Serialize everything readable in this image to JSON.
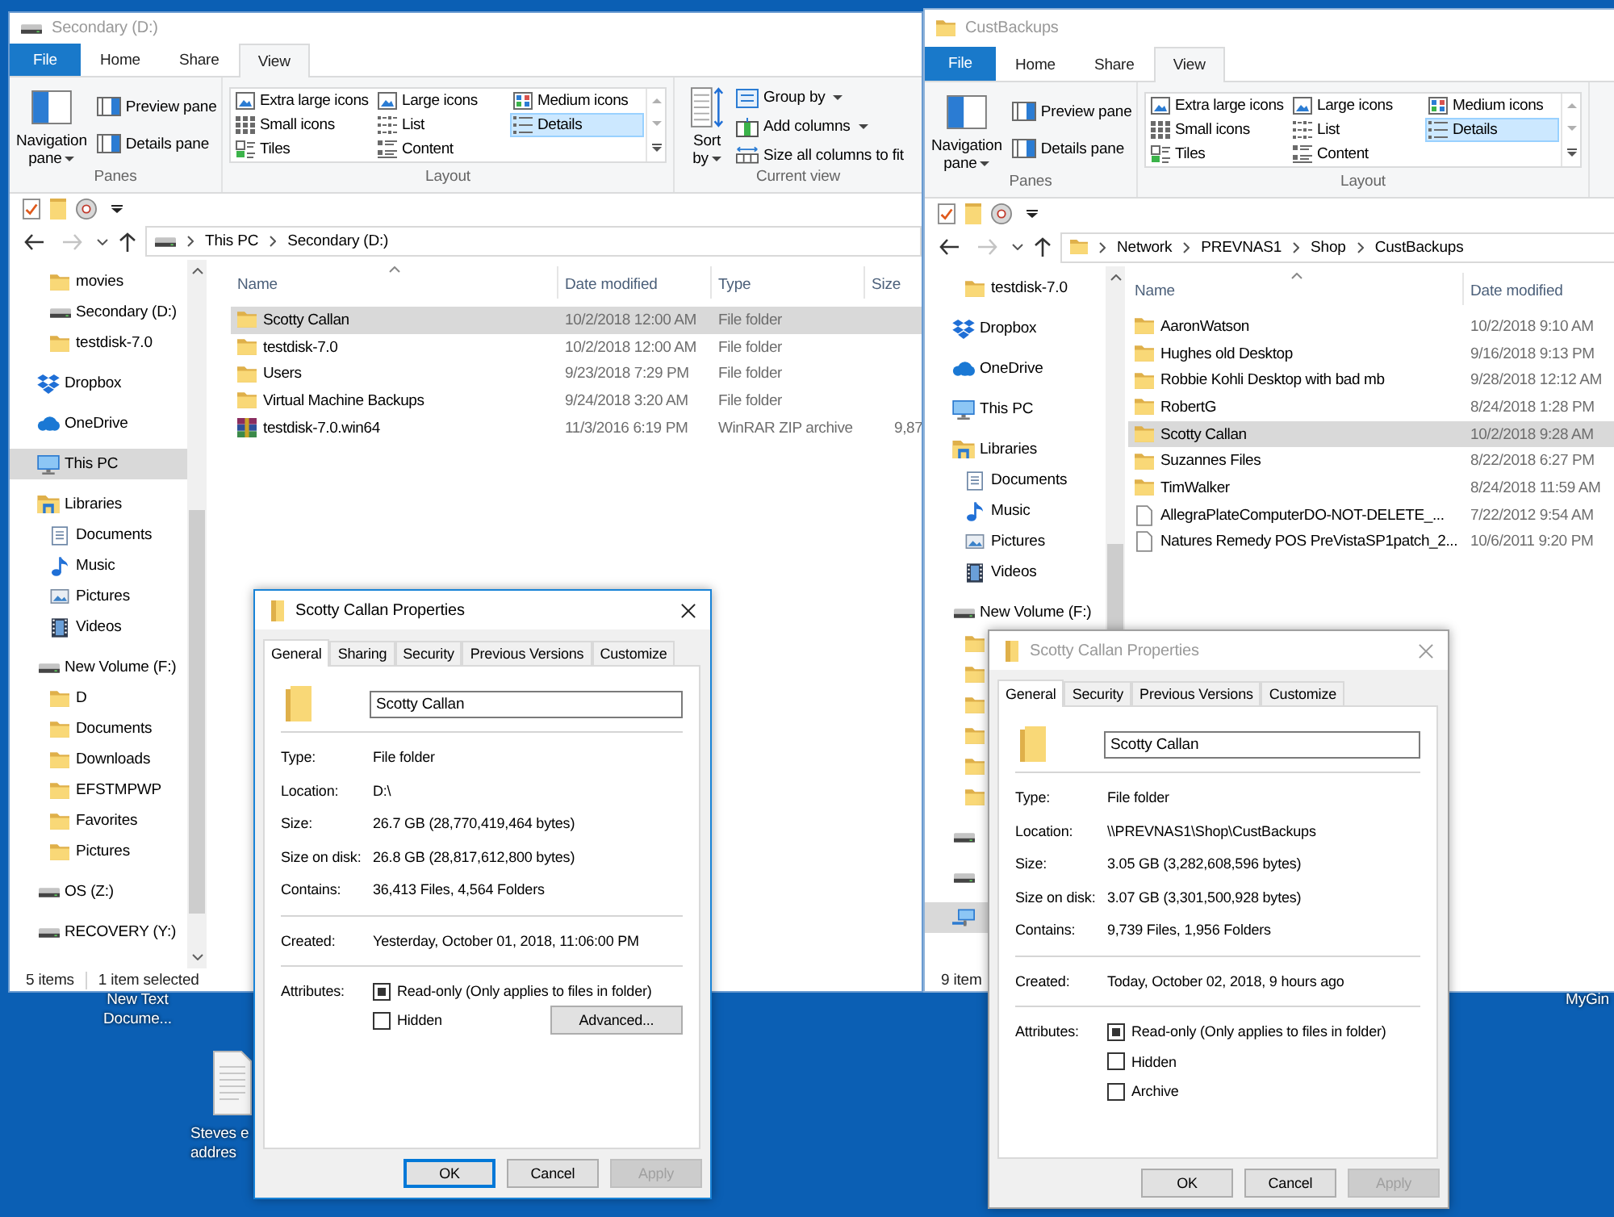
{
  "desktop_icons": [
    {
      "kind": "label",
      "lines": [
        "New Text",
        "Docume..."
      ]
    },
    {
      "kind": "document",
      "lines": [
        "Steves e",
        "addres"
      ]
    },
    {
      "kind": "label",
      "lines": [
        "MyGin"
      ]
    }
  ],
  "explorer_windows": [
    {
      "title": "Secondary (D:)",
      "title_icon": {
        "kind": "drive"
      },
      "active": false,
      "ribbon": {
        "file_tab": "File",
        "tabs": [
          {
            "label": "Home",
            "selected": false
          },
          {
            "label": "Share",
            "selected": false
          },
          {
            "label": "View",
            "selected": true
          }
        ],
        "panes": {
          "label": "Panes",
          "large": {
            "label": "Navigation pane",
            "dropdown": true
          },
          "items": [
            {
              "label": "Preview pane"
            },
            {
              "label": "Details pane"
            }
          ]
        },
        "layout": {
          "label": "Layout",
          "items": [
            {
              "label": "Extra large icons",
              "kind": "picture",
              "selected": false
            },
            {
              "label": "Large icons",
              "kind": "picture",
              "selected": false
            },
            {
              "label": "Medium icons",
              "kind": "squares",
              "selected": false
            },
            {
              "label": "Small icons",
              "kind": "grid",
              "selected": false
            },
            {
              "label": "List",
              "kind": "list",
              "selected": false
            },
            {
              "label": "Details",
              "kind": "details",
              "selected": true
            },
            {
              "label": "Tiles",
              "kind": "tiles",
              "selected": false
            },
            {
              "label": "Content",
              "kind": "content",
              "selected": false
            }
          ]
        },
        "current_view": {
          "label": "Current view",
          "large": {
            "label": "Sort by",
            "dropdown": true
          },
          "items": [
            {
              "label": "Group by",
              "kind": "group",
              "dropdown": true
            },
            {
              "label": "Add columns",
              "kind": "columns",
              "dropdown": true
            },
            {
              "label": "Size all columns to fit",
              "kind": "fit",
              "dropdown": false
            }
          ]
        }
      },
      "address": {
        "root_icon": {
          "kind": "drive"
        },
        "forward_enabled": false,
        "crumbs": [
          "This PC",
          "Secondary (D:)"
        ]
      },
      "nav": {
        "continued_children": [
          {
            "label": "movies",
            "kind": "folder",
            "selected": false
          },
          {
            "label": "Secondary (D:)",
            "kind": "drive",
            "selected": false
          },
          {
            "label": "testdisk-7.0",
            "kind": "folder",
            "selected": false
          }
        ],
        "items": [
          {
            "label": "Dropbox",
            "kind": "dropbox",
            "selected": false
          },
          {
            "label": "OneDrive",
            "kind": "onedrive",
            "selected": false
          },
          {
            "label": "This PC",
            "kind": "pc",
            "selected": true
          },
          {
            "label": "Libraries",
            "kind": "library",
            "selected": false,
            "children": [
              {
                "label": "Documents",
                "kind": "documents",
                "selected": false
              },
              {
                "label": "Music",
                "kind": "music",
                "selected": false
              },
              {
                "label": "Pictures",
                "kind": "pictures",
                "selected": false
              },
              {
                "label": "Videos",
                "kind": "videos",
                "selected": false
              }
            ]
          },
          {
            "label": "New Volume (F:)",
            "kind": "drive",
            "selected": false,
            "children": [
              {
                "label": "D",
                "kind": "folder",
                "selected": false
              },
              {
                "label": "Documents",
                "kind": "folder",
                "selected": false
              },
              {
                "label": "Downloads",
                "kind": "folder",
                "selected": false
              },
              {
                "label": "EFSTMPWP",
                "kind": "folder",
                "selected": false
              },
              {
                "label": "Favorites",
                "kind": "folder",
                "selected": false
              },
              {
                "label": "Pictures",
                "kind": "folder",
                "selected": false
              }
            ]
          },
          {
            "label": "OS (Z:)",
            "kind": "drive",
            "selected": false
          },
          {
            "label": "RECOVERY (Y:)",
            "kind": "drive",
            "selected": false
          }
        ]
      },
      "columns": [
        {
          "label": "Name",
          "sorted": true
        },
        {
          "label": "Date modified",
          "sorted": false
        },
        {
          "label": "Type",
          "sorted": false
        },
        {
          "label": "Size",
          "sorted": false
        }
      ],
      "rows": [
        {
          "kind": "folder",
          "selected": true,
          "cells": [
            "Scotty Callan",
            "10/2/2018 12:00 AM",
            "File folder"
          ]
        },
        {
          "kind": "folder",
          "selected": false,
          "cells": [
            "testdisk-7.0",
            "10/2/2018 12:00 AM",
            "File folder"
          ]
        },
        {
          "kind": "folder",
          "selected": false,
          "cells": [
            "Users",
            "9/23/2018 7:29 PM",
            "File folder"
          ]
        },
        {
          "kind": "folder",
          "selected": false,
          "cells": [
            "Virtual Machine Backups",
            "9/24/2018 3:20 AM",
            "File folder"
          ]
        },
        {
          "kind": "archive",
          "selected": false,
          "cells": [
            "testdisk-7.0.win64",
            "11/3/2016 6:19 PM",
            "WinRAR ZIP archive",
            "9,87"
          ]
        }
      ],
      "status": [
        "5 items",
        "1 item selected"
      ]
    },
    {
      "title": "CustBackups",
      "title_icon": {
        "kind": "folder"
      },
      "active": false,
      "ribbon": {
        "file_tab": "File",
        "tabs": [
          {
            "label": "Home",
            "selected": false
          },
          {
            "label": "Share",
            "selected": false
          },
          {
            "label": "View",
            "selected": true
          }
        ],
        "panes": {
          "label": "Panes",
          "large": {
            "label": "Navigation pane",
            "dropdown": true
          },
          "items": [
            {
              "label": "Preview pane"
            },
            {
              "label": "Details pane"
            }
          ]
        },
        "layout": {
          "label": "Layout",
          "items": [
            {
              "label": "Extra large icons",
              "kind": "picture",
              "selected": false
            },
            {
              "label": "Large icons",
              "kind": "picture",
              "selected": false
            },
            {
              "label": "Medium icons",
              "kind": "squares",
              "selected": false
            },
            {
              "label": "Small icons",
              "kind": "grid",
              "selected": false
            },
            {
              "label": "List",
              "kind": "list",
              "selected": false
            },
            {
              "label": "Details",
              "kind": "details",
              "selected": true
            },
            {
              "label": "Tiles",
              "kind": "tiles",
              "selected": false
            },
            {
              "label": "Content",
              "kind": "content",
              "selected": false
            }
          ]
        }
      },
      "address": {
        "root_icon": {
          "kind": "folder"
        },
        "forward_enabled": false,
        "crumbs": [
          "Network",
          "PREVNAS1",
          "Shop",
          "CustBackups"
        ]
      },
      "nav": {
        "continued_children": [
          {
            "label": "testdisk-7.0",
            "kind": "folder",
            "selected": false
          }
        ],
        "items": [
          {
            "label": "Dropbox",
            "kind": "dropbox",
            "selected": false
          },
          {
            "label": "OneDrive",
            "kind": "onedrive",
            "selected": false
          },
          {
            "label": "This PC",
            "kind": "pc",
            "selected": false
          },
          {
            "label": "Libraries",
            "kind": "library",
            "selected": false,
            "children": [
              {
                "label": "Documents",
                "kind": "documents",
                "selected": false
              },
              {
                "label": "Music",
                "kind": "music",
                "selected": false
              },
              {
                "label": "Pictures",
                "kind": "pictures",
                "selected": false
              },
              {
                "label": "Videos",
                "kind": "videos",
                "selected": false
              }
            ]
          },
          {
            "label": "New Volume (F:)",
            "kind": "drive",
            "selected": false,
            "children": [
              {
                "kind": "folder",
                "selected": false
              },
              {
                "kind": "folder",
                "selected": false
              },
              {
                "kind": "folder",
                "selected": false
              },
              {
                "kind": "folder",
                "selected": false
              },
              {
                "kind": "folder",
                "selected": false
              },
              {
                "kind": "folder",
                "selected": false
              }
            ]
          },
          {
            "kind": "drive",
            "selected": false
          },
          {
            "kind": "drive",
            "selected": false
          },
          {
            "kind": "network",
            "selected": true
          }
        ]
      },
      "columns": [
        {
          "label": "Name",
          "sorted": true
        },
        {
          "label": "Date modified",
          "sorted": false
        }
      ],
      "rows": [
        {
          "kind": "folder",
          "selected": false,
          "cells": [
            "AaronWatson",
            "10/2/2018 9:10 AM"
          ]
        },
        {
          "kind": "folder",
          "selected": false,
          "cells": [
            "Hughes old Desktop",
            "9/16/2018 9:13 PM"
          ]
        },
        {
          "kind": "folder",
          "selected": false,
          "cells": [
            "Robbie Kohli Desktop with bad mb",
            "9/28/2018 12:12 AM"
          ]
        },
        {
          "kind": "folder",
          "selected": false,
          "cells": [
            "RobertG",
            "8/24/2018 1:28 PM"
          ]
        },
        {
          "kind": "folder",
          "selected": true,
          "cells": [
            "Scotty Callan",
            "10/2/2018 9:28 AM"
          ]
        },
        {
          "kind": "folder",
          "selected": false,
          "cells": [
            "Suzannes Files",
            "8/22/2018 6:27 PM"
          ]
        },
        {
          "kind": "folder",
          "selected": false,
          "cells": [
            "TimWalker",
            "8/24/2018 11:59 AM"
          ]
        },
        {
          "kind": "file",
          "selected": false,
          "cells": [
            "AllegraPlateComputerDO-NOT-DELETE_...",
            "7/22/2012 9:54 AM"
          ]
        },
        {
          "kind": "file",
          "selected": false,
          "cells": [
            "Natures Remedy POS PreVistaSP1patch_2...",
            "10/6/2011 9:20 PM"
          ]
        }
      ],
      "status": [
        "9 item"
      ]
    }
  ],
  "dialogs": [
    {
      "title": "Scotty Callan Properties",
      "active": true,
      "tabs": [
        {
          "label": "General",
          "selected": true
        },
        {
          "label": "Sharing",
          "selected": false
        },
        {
          "label": "Security",
          "selected": false
        },
        {
          "label": "Previous Versions",
          "selected": false
        },
        {
          "label": "Customize",
          "selected": false
        }
      ],
      "name_field": {
        "value": "Scotty Callan"
      },
      "sections": [
        [
          {
            "label": "Type:",
            "value": "File folder"
          },
          {
            "label": "Location:",
            "value": "D:\\"
          },
          {
            "label": "Size:",
            "value": "26.7 GB (28,770,419,464 bytes)"
          },
          {
            "label": "Size on disk:",
            "value": "26.8 GB (28,817,612,800 bytes)"
          },
          {
            "label": "Contains:",
            "value": "36,413 Files, 4,564 Folders"
          }
        ],
        [
          {
            "label": "Created:",
            "value": "Yesterday, October 01, 2018, 11:06:00 PM"
          }
        ]
      ],
      "attributes": {
        "label": "Attributes:",
        "checkboxes": [
          {
            "label": "Read-only (Only applies to files in folder)",
            "mixed": true
          },
          {
            "label": "Hidden",
            "mixed": false
          }
        ],
        "advanced_button": "Advanced..."
      },
      "buttons": [
        {
          "label": "OK",
          "default": true,
          "disabled": false
        },
        {
          "label": "Cancel",
          "default": false,
          "disabled": false
        },
        {
          "label": "Apply",
          "default": false,
          "disabled": true
        }
      ]
    },
    {
      "title": "Scotty Callan Properties",
      "active": false,
      "tabs": [
        {
          "label": "General",
          "selected": true
        },
        {
          "label": "Security",
          "selected": false
        },
        {
          "label": "Previous Versions",
          "selected": false
        },
        {
          "label": "Customize",
          "selected": false
        }
      ],
      "name_field": {
        "value": "Scotty Callan"
      },
      "sections": [
        [
          {
            "label": "Type:",
            "value": "File folder"
          },
          {
            "label": "Location:",
            "value": "\\\\PREVNAS1\\Shop\\CustBackups"
          },
          {
            "label": "Size:",
            "value": "3.05 GB (3,282,608,596 bytes)"
          },
          {
            "label": "Size on disk:",
            "value": "3.07 GB (3,301,500,928 bytes)"
          },
          {
            "label": "Contains:",
            "value": "9,739 Files, 1,956 Folders"
          }
        ],
        [
          {
            "label": "Created:",
            "value": "Today, October 02, 2018, 9 hours ago"
          }
        ]
      ],
      "attributes": {
        "label": "Attributes:",
        "checkboxes": [
          {
            "label": "Read-only (Only applies to files in folder)",
            "mixed": true
          },
          {
            "label": "Hidden",
            "mixed": false
          },
          {
            "label": "Archive",
            "mixed": false
          }
        ]
      },
      "buttons": [
        {
          "label": "OK",
          "default": false,
          "disabled": false
        },
        {
          "label": "Cancel",
          "default": false,
          "disabled": false
        },
        {
          "label": "Apply",
          "default": false,
          "disabled": true
        }
      ]
    }
  ]
}
